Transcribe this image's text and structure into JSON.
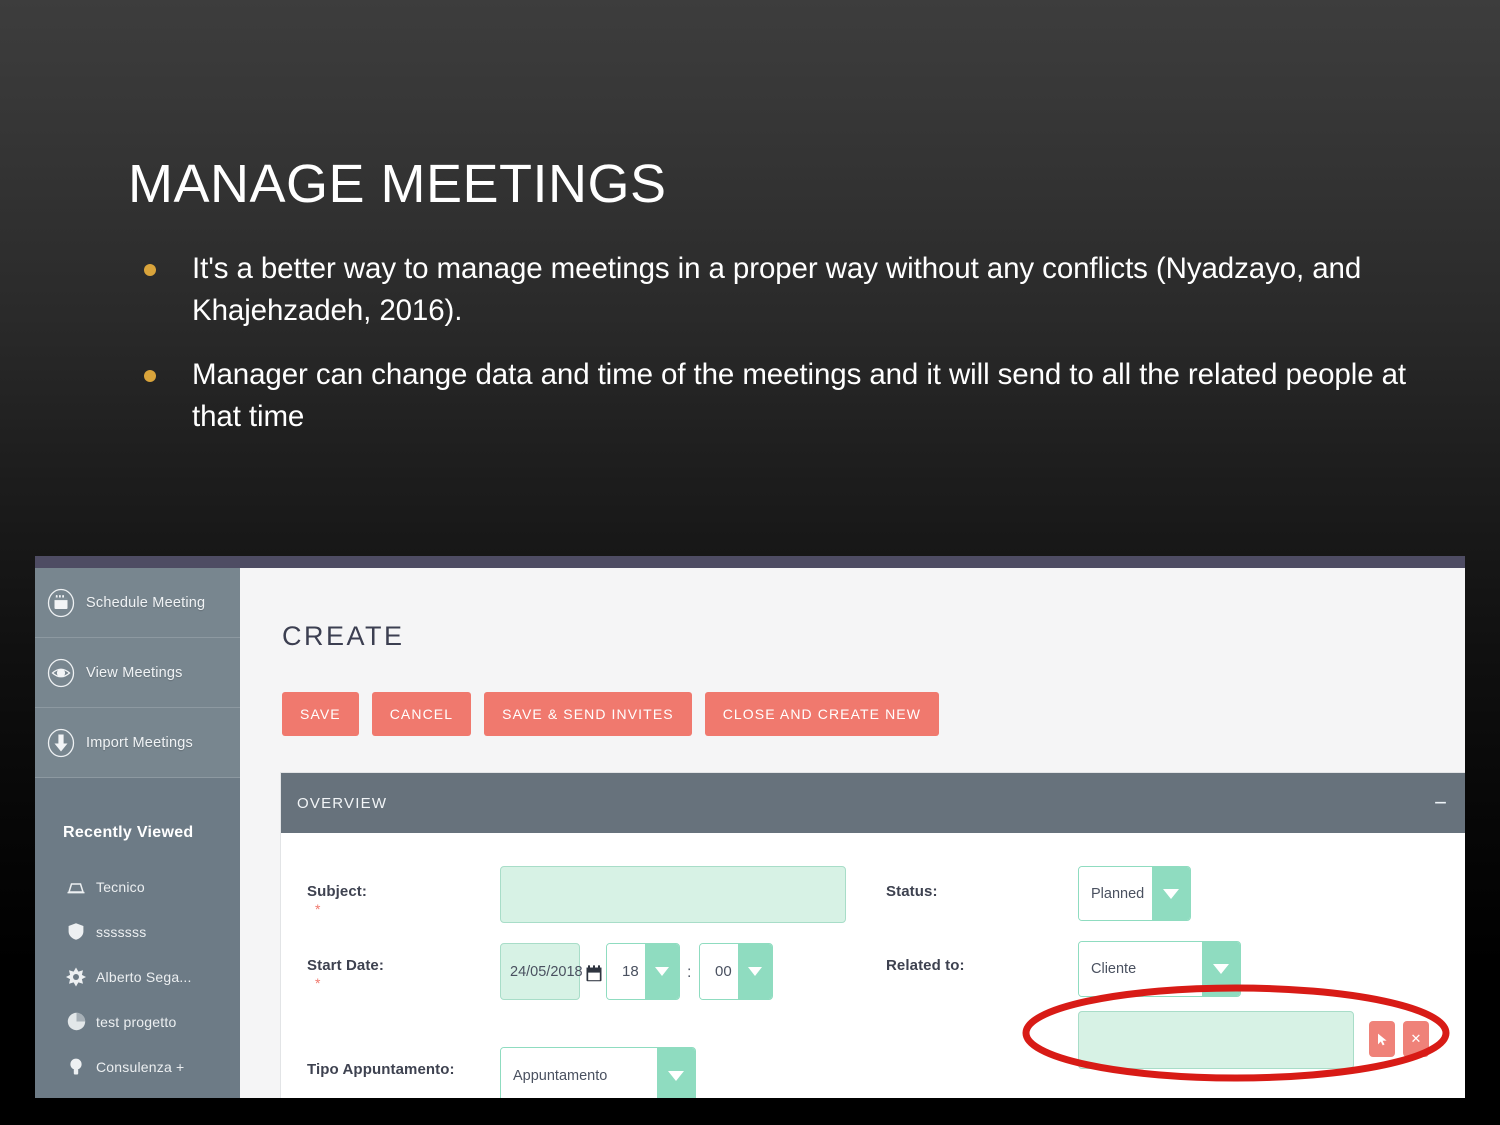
{
  "slide": {
    "title": "MANAGE MEETINGS",
    "bullets": [
      "It's a better way to manage meetings in a proper way without any conflicts (Nyadzayo, and Khajehzadeh, 2016).",
      "Manager can change data and time of the meetings and it will send to all the related people at that time"
    ],
    "bullet_color": "#D9A43B",
    "text_color": "#FFFFFF",
    "background": "#2a2a2a"
  },
  "app": {
    "topbar_color": "#4E4C63",
    "accent_button_color": "#F0796E",
    "field_fill_color": "#D7F2E5",
    "dropdown_accent_color": "#8FDCC0",
    "panel_header_color": "#67727C",
    "sidebar": {
      "background": "#6D7B86",
      "nav": [
        {
          "label": "Schedule Meeting",
          "icon": "calendar-icon"
        },
        {
          "label": "View Meetings",
          "icon": "eye-icon"
        },
        {
          "label": "Import Meetings",
          "icon": "download-arrow-icon"
        }
      ],
      "recently_viewed_heading": "Recently Viewed",
      "recent_items": [
        {
          "label": "Tecnico",
          "icon": "briefcase-icon"
        },
        {
          "label": "sssssss",
          "icon": "shield-icon"
        },
        {
          "label": "Alberto Sega...",
          "icon": "starburst-icon"
        },
        {
          "label": "test progetto",
          "icon": "pie-chart-icon"
        },
        {
          "label": "Consulenza +",
          "icon": "lightbulb-icon"
        }
      ],
      "collapse_glyph": "◁"
    },
    "main": {
      "page_title": "CREATE",
      "buttons": [
        "SAVE",
        "CANCEL",
        "SAVE & SEND INVITES",
        "CLOSE AND CREATE NEW"
      ],
      "panel": {
        "title": "OVERVIEW",
        "minimize_glyph": "−",
        "fields": {
          "subject": {
            "label": "Subject:",
            "required": "*",
            "value": "",
            "placeholder": ""
          },
          "start_date": {
            "label": "Start Date:",
            "required": "*",
            "date_value": "24/05/2018",
            "hour_value": "18",
            "minute_value": "00",
            "separator": ":"
          },
          "status": {
            "label": "Status:",
            "value": "Planned"
          },
          "related_to": {
            "label": "Related to:",
            "value": "Cliente",
            "lookup_value": "",
            "lookup_buttons": [
              {
                "name": "select-lookup",
                "glyph": "↖"
              },
              {
                "name": "clear-lookup",
                "glyph": "✕"
              }
            ]
          },
          "tipo_appuntamento": {
            "label": "Tipo Appuntamento:",
            "value": "Appuntamento"
          }
        }
      }
    }
  },
  "annotation": {
    "shape": "ellipse",
    "color": "#D81B16",
    "target": "related-to-lookup-field"
  }
}
